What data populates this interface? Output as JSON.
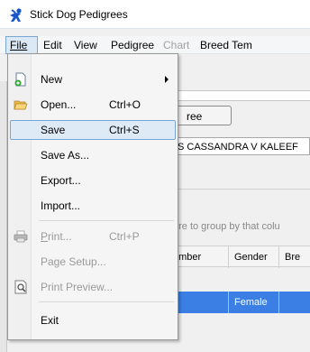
{
  "app": {
    "title": "Stick Dog Pedigrees"
  },
  "menubar": {
    "items": [
      "File",
      "Edit",
      "View",
      "Pedigree",
      "Chart",
      "Breed Tem"
    ]
  },
  "file_menu": {
    "new": "New",
    "open": "Open...",
    "open_shortcut": "Ctrl+O",
    "save": "Save",
    "save_shortcut": "Ctrl+S",
    "save_as": "Save As...",
    "export": "Export...",
    "import": "Import...",
    "print": "Print...",
    "print_shortcut": "Ctrl+P",
    "page_setup": "Page Setup...",
    "print_preview": "Print Preview...",
    "exit": "Exit"
  },
  "background": {
    "tree_button": "ree",
    "dog_name": "S CASSANDRA V KALEEF",
    "group_hint": "ere to group by that colu",
    "grid_headers": [
      "umber",
      "Gender",
      "Bre"
    ],
    "row_gender": "Female"
  },
  "colors": {
    "accent": "#3b7fe4",
    "menu_highlight": "#dfeaf7"
  }
}
